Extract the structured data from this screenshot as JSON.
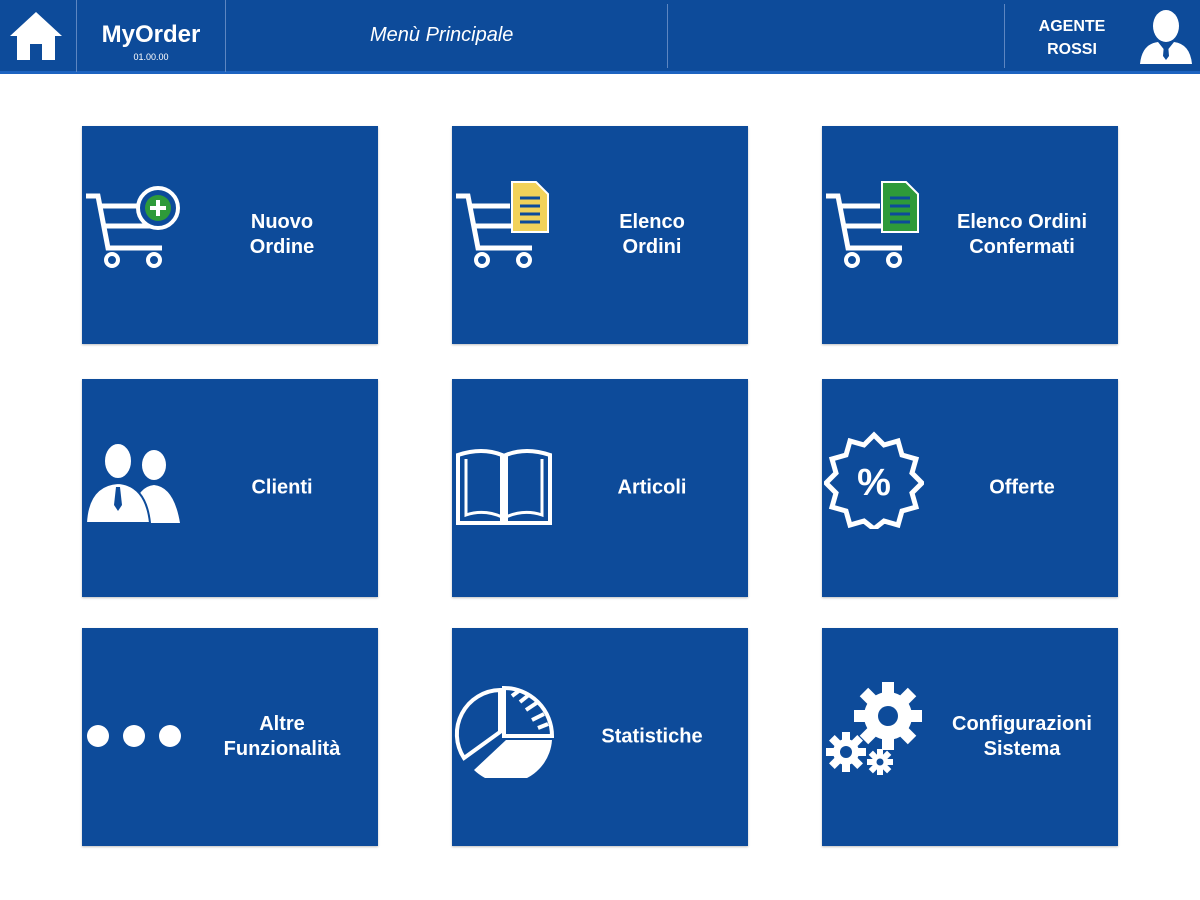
{
  "header": {
    "app_name": "MyOrder",
    "version": "01.00.00",
    "menu_title": "Menù Principale",
    "agent_line1": "AGENTE",
    "agent_line2": "ROSSI"
  },
  "tiles": [
    {
      "label": "Nuovo\nOrdine",
      "icon": "cart-add-icon"
    },
    {
      "label": "Elenco\nOrdini",
      "icon": "cart-document-icon"
    },
    {
      "label": "Elenco Ordini\nConfermati",
      "icon": "cart-confirmed-document-icon"
    },
    {
      "label": "Clienti",
      "icon": "customers-icon"
    },
    {
      "label": "Articoli",
      "icon": "open-book-icon"
    },
    {
      "label": "Offerte",
      "icon": "percent-badge-icon"
    },
    {
      "label": "Altre\nFunzionalità",
      "icon": "more-dots-icon"
    },
    {
      "label": "Statistiche",
      "icon": "pie-chart-icon"
    },
    {
      "label": "Configurazioni\nSistema",
      "icon": "gears-icon"
    }
  ],
  "colors": {
    "primary": "#0d4b9a",
    "accent_green": "#2e9a3a",
    "accent_yellow": "#f2d25a",
    "white": "#ffffff"
  }
}
